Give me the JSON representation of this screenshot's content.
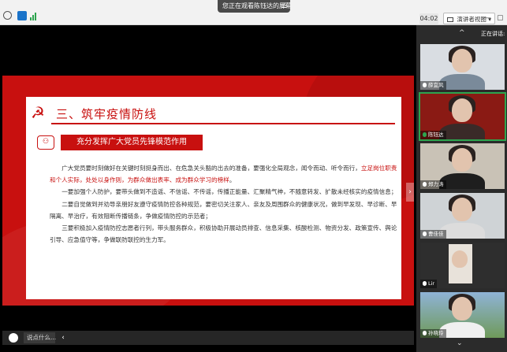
{
  "topbar": {
    "share_notice": "您正在观看陈钰达的屏幕",
    "menu_icon": "hamburger-icon",
    "timer": "04:02",
    "presenter_view_label": "演讲者视图",
    "presenter_view_chevron": "▾"
  },
  "slide": {
    "icon": "hammer-sickle-icon",
    "title": "三、筑牢疫情防线",
    "subtitle": "充分发挥广大党员先锋模范作用",
    "paragraphs": [
      {
        "before": "广大党员要时刻做好在关键时刻挺身而出、在危急关头豁的出去的准备，要强化全局观念，闻令而动、听令而行，",
        "highlight": "立足岗位职责和个人实际，处处以身作则，为群众做出表率、成为群众学习的榜样",
        "after": "。"
      },
      {
        "before": "一要加强个人防护，要带头做到不造谣、不信谣、不传谣，传播正能量、汇聚精气神，不随意转发、扩散未经核实的疫情信息；",
        "highlight": "",
        "after": ""
      },
      {
        "before": "二要自觉做到并劝导亲朋好友遵守疫情防控各种规范，要密切关注家人、亲友及周围群众的健康状况，做到早发现、早诊断、早隔离、早治疗，有效阻断传播链条，争做疫情防控的示范者；",
        "highlight": "",
        "after": ""
      },
      {
        "before": "三要积极加入疫情防控志愿者行列，带头服务群众，积极协助开展动员排查、信息采集、核酸检测、物资分发、政策宣传、舆论引导、应急值守等，争做联防联控的生力军。",
        "highlight": "",
        "after": ""
      }
    ]
  },
  "chat": {
    "placeholder": "说点什么...",
    "toggle": "‹"
  },
  "panel": {
    "collapse_chevron": "^",
    "speaking_label": "正在讲话:",
    "expand_chevron": "⌄",
    "participants": [
      {
        "name": "薛宜风",
        "active": false
      },
      {
        "name": "陈钰达",
        "active": true
      },
      {
        "name": "郑力涛",
        "active": false
      },
      {
        "name": "曹佳佳",
        "active": false
      },
      {
        "name": "Lir",
        "active": false
      },
      {
        "name": "孙晓玲",
        "active": false
      }
    ]
  },
  "colors": {
    "party_red": "#c8100f",
    "active_speaker": "#2da44e",
    "panel_bg": "#2b2b2b"
  }
}
